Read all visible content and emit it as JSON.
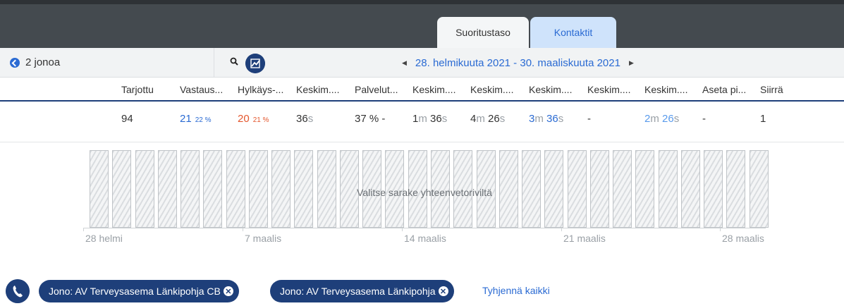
{
  "tabs": [
    {
      "label": "Suoritustaso",
      "active": true
    },
    {
      "label": "Kontaktit",
      "active": false
    }
  ],
  "toolbar": {
    "back_label": "2 jonoa",
    "date_range": "28. helmikuuta 2021 - 30. maaliskuuta 2021"
  },
  "columns": [
    "Tarjottu",
    "Vastaus...",
    "Hylkäys-...",
    "Keskim....",
    "Palvelut...",
    "Keskim....",
    "Keskim....",
    "Keskim....",
    "Keskim....",
    "Keskim....",
    "Aseta pi...",
    "Siirrä"
  ],
  "row": {
    "offered": "94",
    "answered": "21",
    "answered_pct": "22 %",
    "abandoned": "20",
    "abandoned_pct": "21 %",
    "avg_wait_num": "36",
    "avg_wait_unit": "s",
    "service_level": "37 % -",
    "c6_min": "1",
    "c6_m": "m",
    "c6_sec": "36",
    "c6_s": "s",
    "c7_min": "4",
    "c7_m": "m",
    "c7_sec": "26",
    "c7_s": "s",
    "c8_min": "3",
    "c8_m": "m",
    "c8_sec": "36",
    "c8_s": "s",
    "c9": "-",
    "c10_min": "2",
    "c10_m": "m",
    "c10_sec": "26",
    "c10_s": "s",
    "c11": "-",
    "c12": "1"
  },
  "chart": {
    "message": "Valitse sarake yhteenvetoriviltä",
    "x_labels": [
      "28 helmi",
      "7 maalis",
      "14 maalis",
      "21 maalis",
      "28 maalis"
    ]
  },
  "footer": {
    "chips": [
      "Jono: AV Terveysasema Länkipohja CB",
      "Jono: AV Terveysasema Länkipohja"
    ],
    "clear_label": "Tyhjennä kaikki"
  },
  "colors": {
    "accent": "#2b6bd3",
    "dark_blue": "#1e3f7a",
    "abandon_red": "#e4572e",
    "topbar": "#444a4f"
  }
}
